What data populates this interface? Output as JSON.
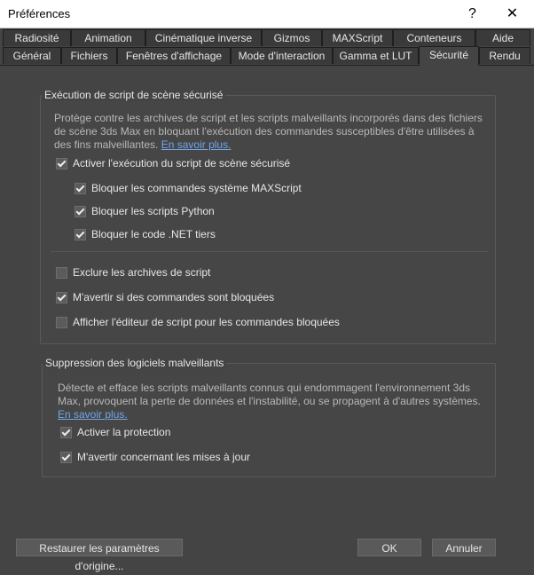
{
  "window": {
    "title": "Préférences",
    "help_glyph": "?",
    "close_glyph": "✕"
  },
  "tabs_row1": [
    {
      "label": "Radiosité"
    },
    {
      "label": "Animation"
    },
    {
      "label": "Cinématique inverse"
    },
    {
      "label": "Gizmos"
    },
    {
      "label": "MAXScript"
    },
    {
      "label": "Conteneurs"
    },
    {
      "label": "Aide"
    }
  ],
  "tabs_row2": [
    {
      "label": "Général"
    },
    {
      "label": "Fichiers"
    },
    {
      "label": "Fenêtres d'affichage"
    },
    {
      "label": "Mode d'interaction"
    },
    {
      "label": "Gamma et LUT"
    },
    {
      "label": "Sécurité",
      "active": true
    },
    {
      "label": "Rendu"
    }
  ],
  "safe_scene": {
    "title": "Exécution de script de scène sécurisé",
    "description": "Protège contre les archives de script et les scripts malveillants incorporés dans des fichiers de scène 3ds Max en bloquant l'exécution des commandes susceptibles d'être utilisées à des fins malveillantes.",
    "learn_more": "En savoir plus.",
    "enable": {
      "label": "Activer l'exécution du script de scène sécurisé",
      "checked": true
    },
    "sub": [
      {
        "label": "Bloquer les commandes système MAXScript",
        "checked": true
      },
      {
        "label": "Bloquer les scripts Python",
        "checked": true
      },
      {
        "label": "Bloquer le code .NET tiers",
        "checked": true
      }
    ],
    "options": [
      {
        "label": "Exclure les archives de script",
        "checked": false
      },
      {
        "label": "M'avertir si des commandes sont bloquées",
        "checked": true
      },
      {
        "label": "Afficher l'éditeur de script pour les commandes bloquées",
        "checked": false
      }
    ]
  },
  "malware": {
    "title": "Suppression des logiciels malveillants",
    "description": "Détecte et efface les scripts malveillants connus qui endommagent l'environnement 3ds Max, provoquent la perte de données et l'instabilité, ou se propagent à d'autres systèmes.",
    "learn_more_1": "En savoir",
    "learn_more_2": "plus.",
    "options": [
      {
        "label": "Activer la protection",
        "checked": true
      },
      {
        "label": "M'avertir concernant les mises à jour",
        "checked": true
      }
    ]
  },
  "buttons": {
    "restore": "Restaurer les paramètres d'origine...",
    "ok": "OK",
    "cancel": "Annuler"
  }
}
